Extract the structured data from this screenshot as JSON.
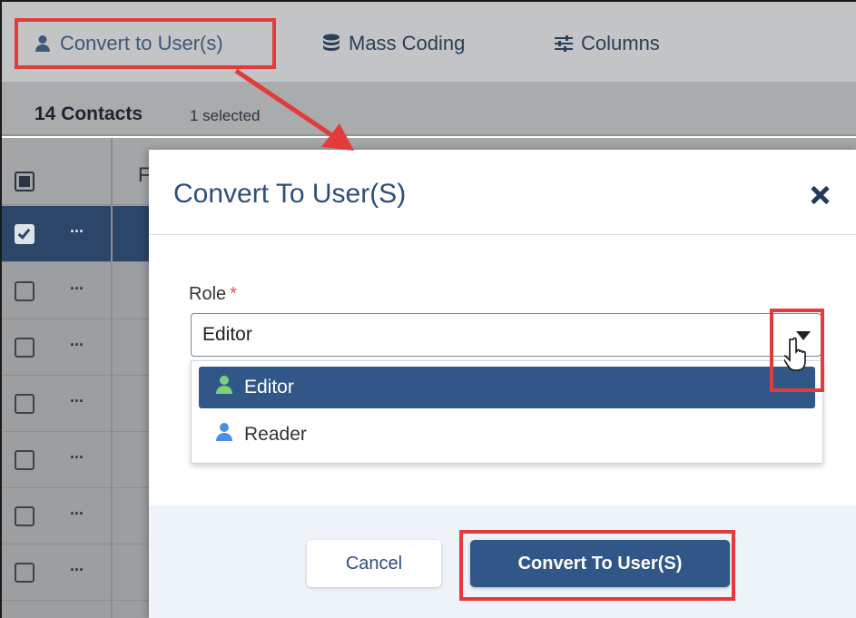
{
  "toolbar": {
    "convert_label": "Convert to User(s)",
    "mass_coding_label": "Mass Coding",
    "columns_label": "Columns"
  },
  "subbar": {
    "count_label": "14 Contacts",
    "selected_label": "1 selected"
  },
  "grid": {
    "header_partial": "F",
    "row_action_label": "···",
    "rows": [
      {
        "selected": true
      },
      {
        "selected": false
      },
      {
        "selected": false
      },
      {
        "selected": false
      },
      {
        "selected": false
      },
      {
        "selected": false
      },
      {
        "selected": false
      }
    ]
  },
  "modal": {
    "title": "Convert To User(S)",
    "role_label": "Role",
    "required_mark": "*",
    "role_value": "Editor",
    "options": [
      {
        "label": "Editor",
        "icon": "user-icon",
        "icon_color": "#7ed07a",
        "selected": true
      },
      {
        "label": "Reader",
        "icon": "user-icon",
        "icon_color": "#4a90e2",
        "selected": false
      }
    ],
    "cancel_label": "Cancel",
    "convert_label": "Convert To User(S)"
  },
  "colors": {
    "accent": "#305787",
    "annotation": "#e23b3b"
  }
}
